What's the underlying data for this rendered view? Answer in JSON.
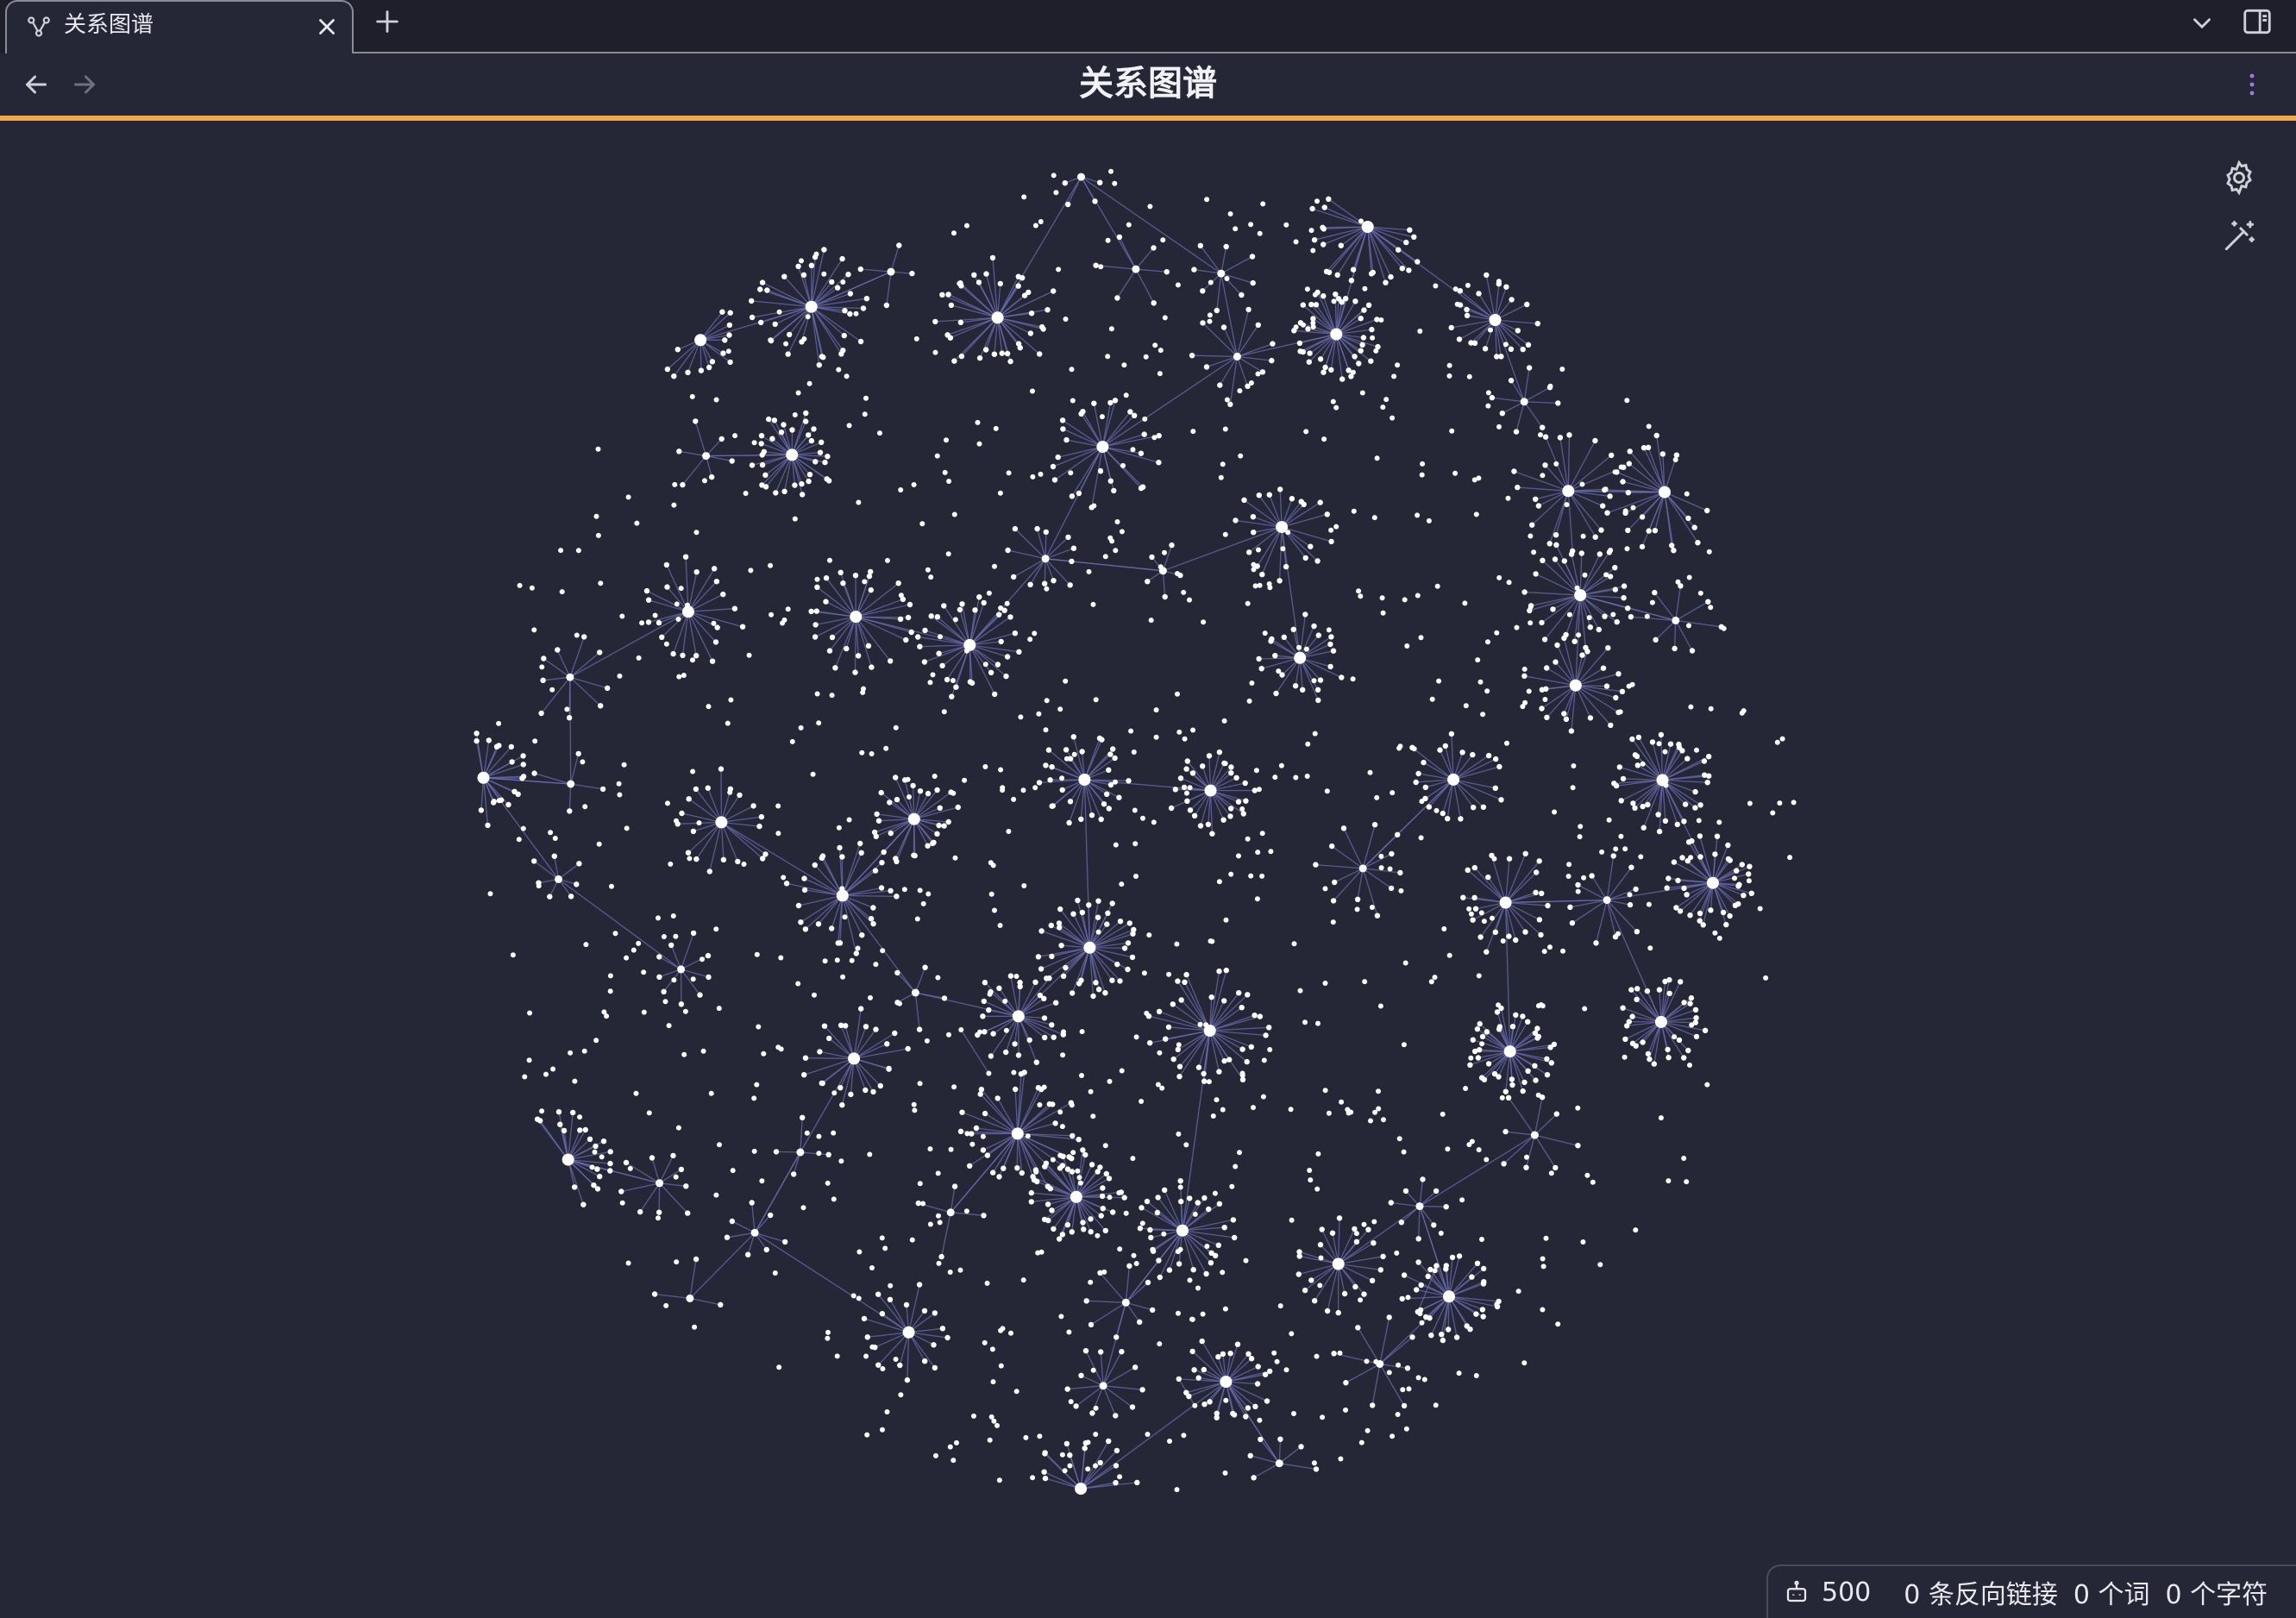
{
  "tab": {
    "title": "关系图谱",
    "icon": "graph-icon",
    "close_icon": "close-icon",
    "new_tab_icon": "plus-icon"
  },
  "toolbar": {
    "back_icon": "arrow-left-icon",
    "forward_icon": "arrow-right-icon",
    "more_icon": "more-vertical-icon",
    "dropdown_icon": "chevron-down-icon",
    "sidebar_icon": "sidebar-toggle-icon"
  },
  "header": {
    "title": "关系图谱"
  },
  "graph_controls": {
    "settings_icon": "gear-icon",
    "animate_icon": "magic-wand-icon"
  },
  "colors": {
    "background": "#262736",
    "tabbar": "#1e1f2b",
    "accent": "#f0a84a",
    "node": "#ffffff",
    "edge": "#6a6cb0"
  },
  "status": {
    "count_icon": "robot-icon",
    "count": "500",
    "backlinks": "0 条反向链接",
    "words": "0 个词",
    "chars": "0 个字符"
  }
}
